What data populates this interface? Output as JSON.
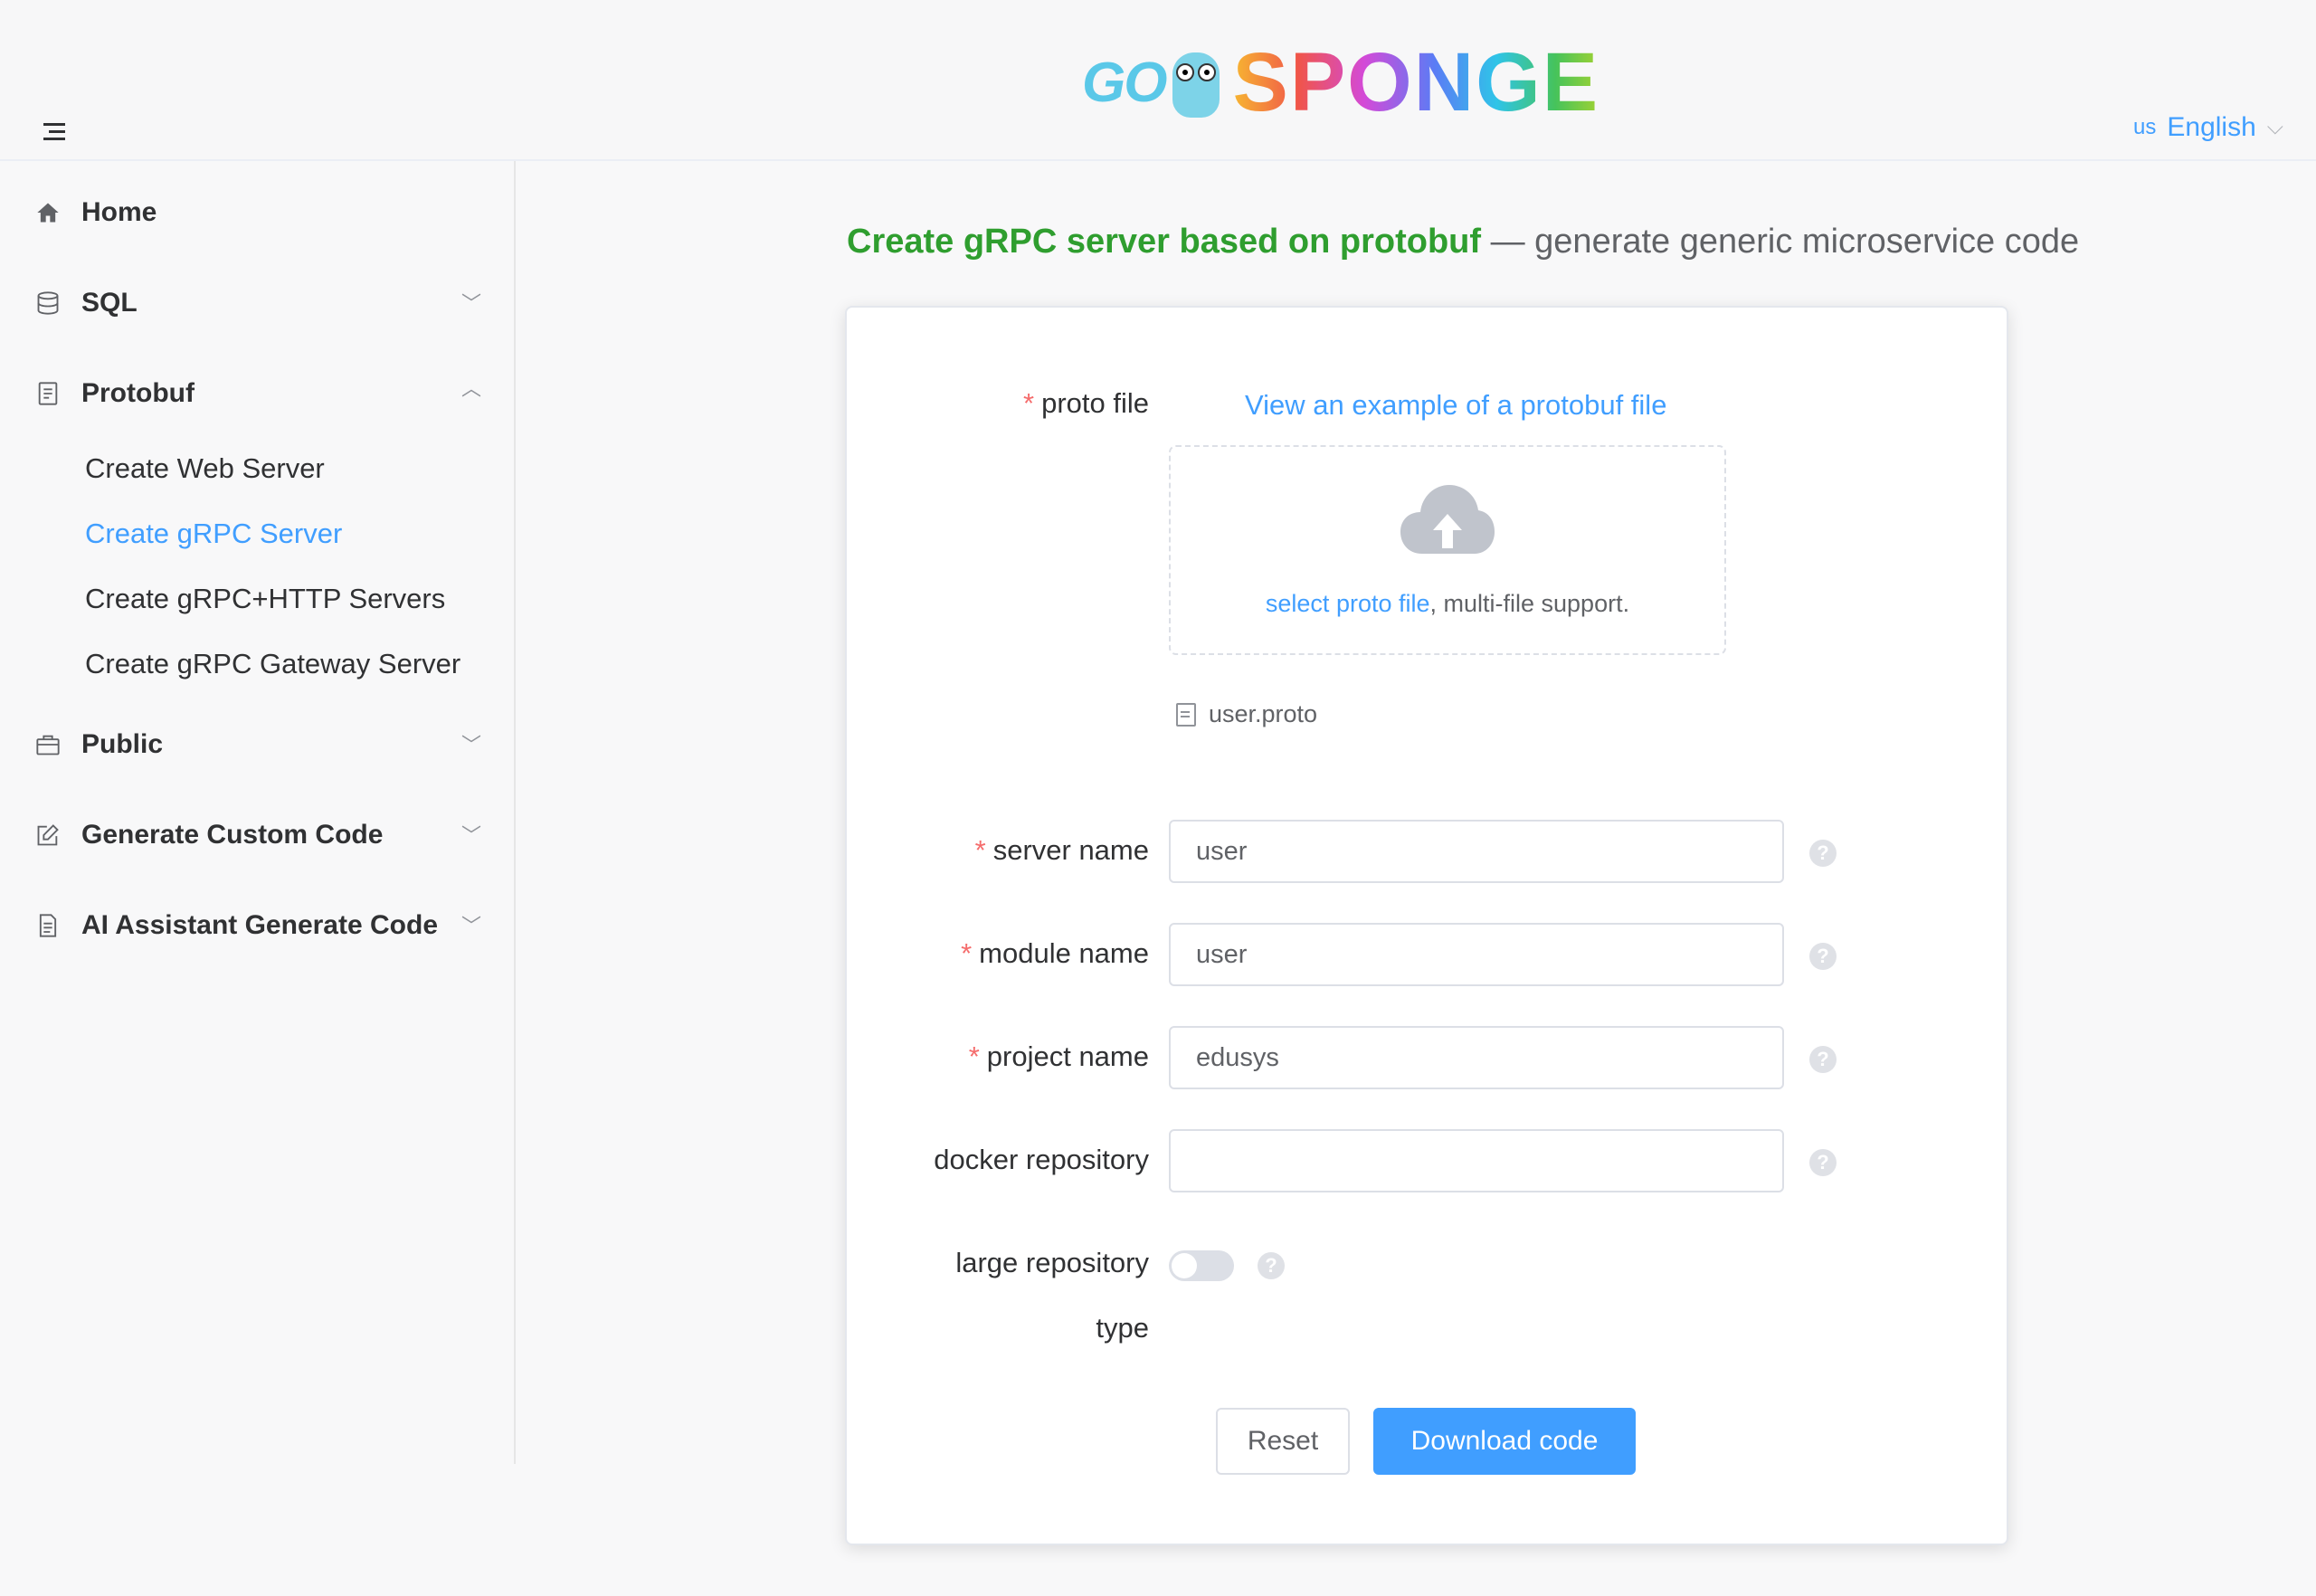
{
  "header": {
    "logo_go": "GO",
    "logo_sponge": "SPONGE",
    "language": {
      "flag": "us",
      "label": "English"
    }
  },
  "sidebar": {
    "items": [
      {
        "label": "Home",
        "icon": "home-icon"
      },
      {
        "label": "SQL",
        "icon": "database-icon"
      },
      {
        "label": "Protobuf",
        "icon": "document-icon"
      },
      {
        "label": "Public",
        "icon": "briefcase-icon"
      },
      {
        "label": "Generate Custom Code",
        "icon": "edit-icon"
      },
      {
        "label": "AI Assistant Generate Code",
        "icon": "document-list-icon"
      }
    ],
    "protobuf_sub": [
      {
        "label": "Create Web Server"
      },
      {
        "label": "Create gRPC Server",
        "active": true
      },
      {
        "label": "Create gRPC+HTTP Servers"
      },
      {
        "label": "Create gRPC Gateway Server"
      }
    ]
  },
  "main": {
    "title_strong": "Create gRPC server based on protobuf",
    "title_rest": " — generate generic microservice code",
    "form": {
      "proto_file_label": "proto file",
      "example_link": "View an example of a protobuf file",
      "upload_link": "select proto file",
      "upload_rest": ", multi-file support.",
      "uploaded_file": "user.proto",
      "server_name_label": "server name",
      "server_name_value": "user",
      "module_name_label": "module name",
      "module_name_value": "user",
      "project_name_label": "project name",
      "project_name_value": "edusys",
      "docker_repo_label": "docker repository",
      "docker_repo_value": "",
      "large_repo_label_1": "large repository",
      "large_repo_label_2": "type",
      "large_repo_enabled": false,
      "reset_label": "Reset",
      "download_label": "Download code"
    }
  },
  "colors": {
    "accent": "#409eff",
    "title_green": "#2f9e2f",
    "required": "#f56c6c"
  }
}
